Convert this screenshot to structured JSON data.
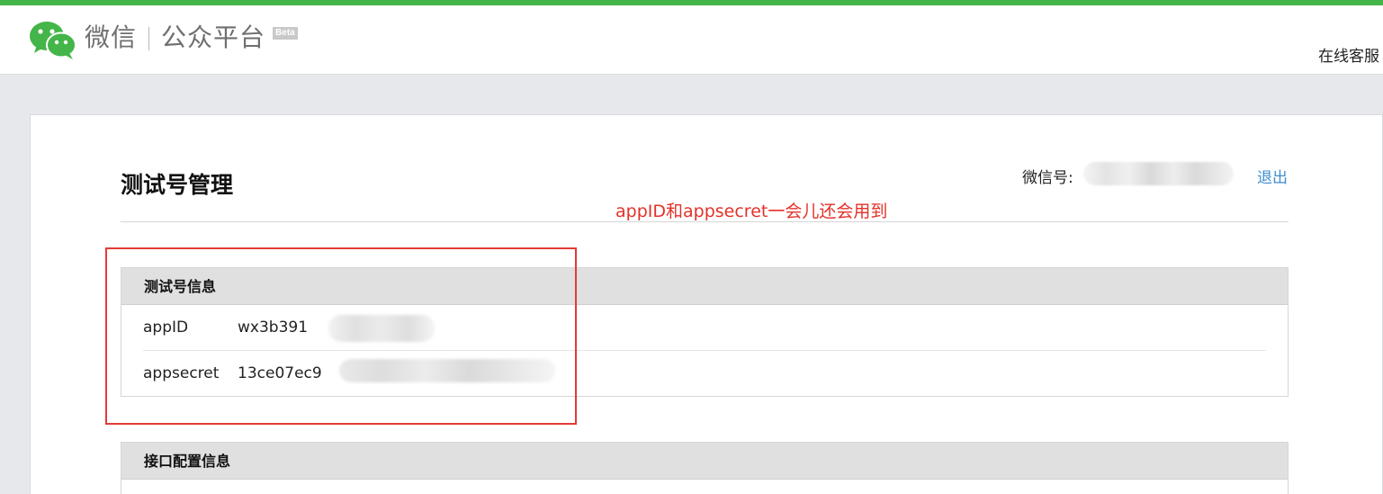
{
  "header": {
    "logo_text_1": "微信",
    "logo_text_2": "公众平台",
    "beta_badge": "Beta",
    "service_link": "在线客服",
    "logo_icon": "wechat-logo-icon"
  },
  "page": {
    "title": "测试号管理",
    "account_label": "微信号:",
    "logout_link": "退出",
    "annotation": "appID和appsecret一会儿还会用到"
  },
  "test_account_info": {
    "heading": "测试号信息",
    "rows": [
      {
        "label": "appID",
        "value": "wx3b391"
      },
      {
        "label": "appsecret",
        "value": "13ce07ec9"
      }
    ]
  },
  "interface_config": {
    "heading": "接口配置信息"
  },
  "colors": {
    "brand_green": "#44b549",
    "link_blue": "#3e8ed0",
    "annotation_red": "#e2322a"
  }
}
